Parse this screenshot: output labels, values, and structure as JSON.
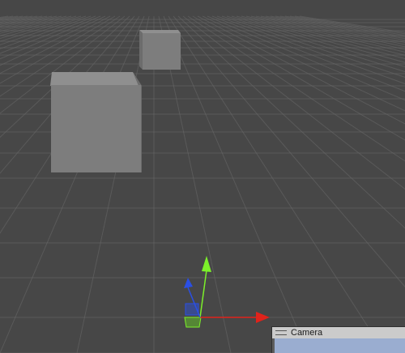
{
  "scene": {
    "background": "#474747",
    "grid_color": "#6a6a6a",
    "cube_colors": {
      "front": "#7d7d7d",
      "top": "#8f8f8f",
      "side": "#6c6c6c"
    }
  },
  "gizmo": {
    "x_axis_color": "#e0231b",
    "y_axis_color": "#7cf02a",
    "z_axis_color": "#2a4fe5"
  },
  "camera_preview": {
    "title": "Camera",
    "preview_color": "#9aadd0"
  }
}
